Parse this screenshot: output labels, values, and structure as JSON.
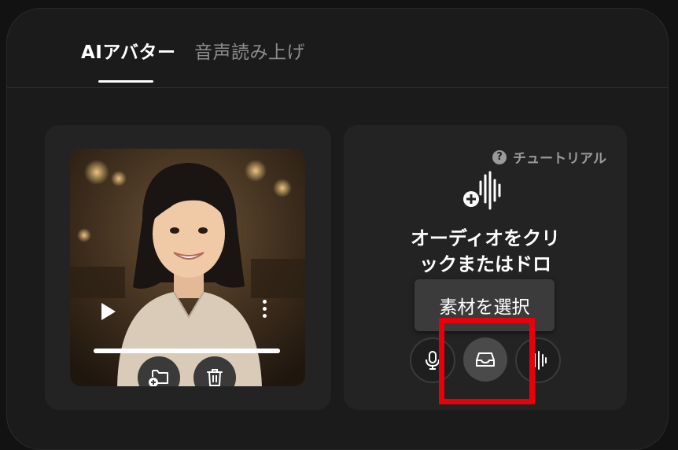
{
  "tabs": [
    {
      "label": "AIアバター",
      "active": true
    },
    {
      "label": "音声読み上げ",
      "active": false
    }
  ],
  "avatar_card": {
    "progress": 1.0,
    "buttons": {
      "play": "play-icon",
      "more": "more-vertical-icon",
      "change_folder": "folder-add-icon",
      "delete": "trash-icon"
    }
  },
  "audio_card": {
    "tutorial_label": "チュートリアル",
    "drop_text_line1": "オーディオをクリ",
    "drop_text_line2": "ックまたはドロ",
    "tooltip": "素材を選択",
    "buttons": {
      "record": "microphone-icon",
      "select_material": "inbox-icon",
      "voice": "waveform-icon"
    }
  },
  "colors": {
    "background": "#1b1b1b",
    "card": "#232323",
    "highlight": "#e8000b",
    "active_tab": "#ffffff",
    "inactive_tab": "#8c8c8c"
  }
}
